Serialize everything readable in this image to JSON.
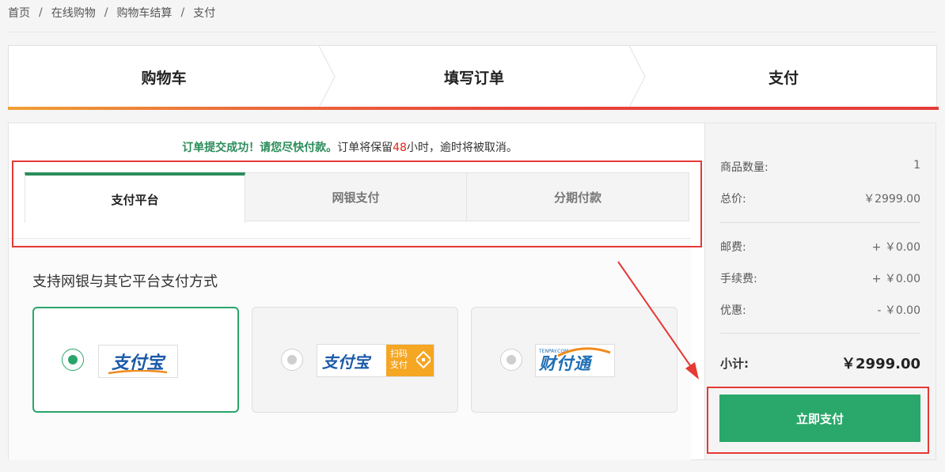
{
  "breadcrumb": [
    "首页",
    "在线购物",
    "购物车结算",
    "支付"
  ],
  "steps": [
    "购物车",
    "填写订单",
    "支付"
  ],
  "notice": {
    "success": "订单提交成功！请您尽快付款。",
    "keep_prefix": "订单将保留",
    "hours": "48",
    "keep_suffix": "小时，逾时将被取消。"
  },
  "tabs": [
    "支付平台",
    "网银支付",
    "分期付款"
  ],
  "pay_title": "支持网银与其它平台支付方式",
  "platforms": [
    {
      "name": "支付宝",
      "selected": true
    },
    {
      "name": "支付宝",
      "badge": "扫码\n支付",
      "selected": false
    },
    {
      "name": "财付通",
      "small": "TENPAY.COM",
      "selected": false
    }
  ],
  "summary": {
    "qty_label": "商品数量:",
    "qty": "1",
    "total_label": "总价:",
    "total": "￥2999.00",
    "postage_label": "邮费:",
    "postage": "+ ￥0.00",
    "fee_label": "手续费:",
    "fee": "+ ￥0.00",
    "discount_label": "优惠:",
    "discount": "- ￥0.00",
    "subtotal_label": "小计:",
    "subtotal": "￥2999.00",
    "pay_button": "立即支付"
  },
  "colors": {
    "accent_green": "#2aa86b",
    "success_text": "#2a8c5a",
    "highlight_red": "#e2231a",
    "annotation_red": "#e53935"
  }
}
